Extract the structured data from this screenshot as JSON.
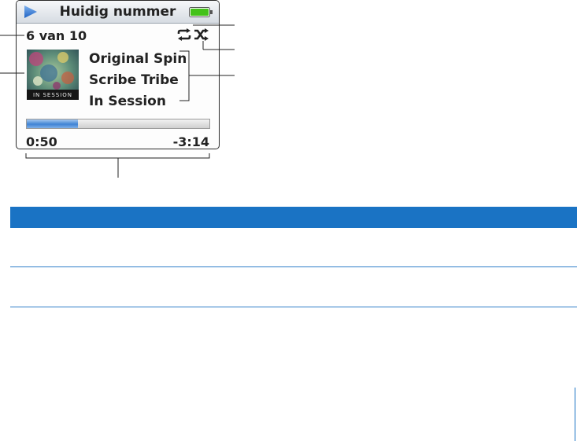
{
  "screen": {
    "title": "Huidig nummer",
    "track_count": "6 van 10",
    "song_title": "Original Spin",
    "artist": "Scribe Tribe",
    "album": "In Session",
    "time_elapsed": "0:50",
    "time_remaining": "-3:14",
    "progress_fraction": 0.28,
    "album_art_text": "IN SESSION",
    "icons": [
      "play-icon",
      "battery-icon",
      "repeat-icon",
      "shuffle-icon"
    ],
    "colors": {
      "accent_blue": "#3f83d4",
      "battery_green": "#44c21a",
      "table_header_blue": "#1a73c4"
    }
  },
  "table": {
    "header": [
      "",
      ""
    ],
    "rows": [
      [
        "",
        ""
      ],
      [
        "",
        ""
      ]
    ]
  }
}
